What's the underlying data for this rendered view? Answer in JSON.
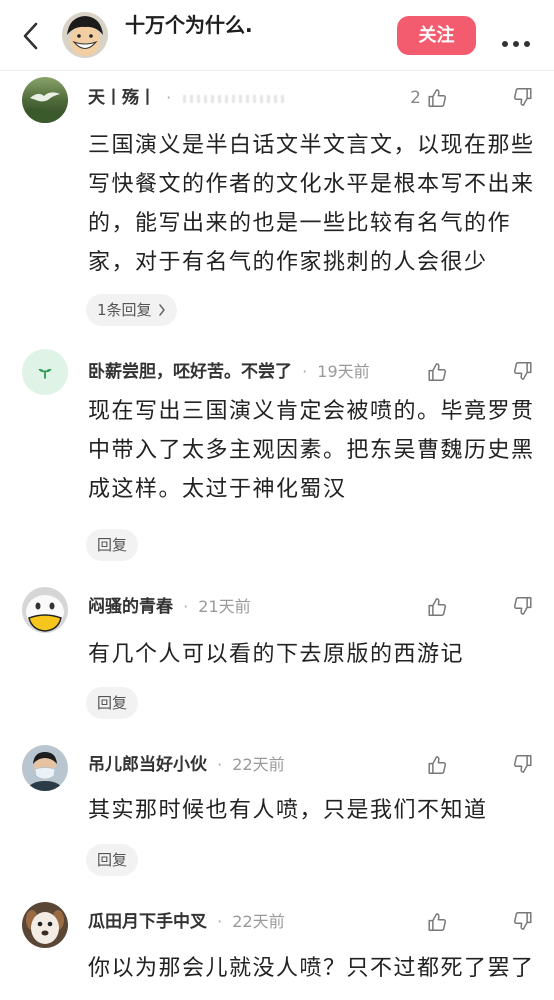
{
  "header": {
    "title": "十万个为什么.",
    "follow_label": "关注",
    "follow_color": "#f35b6e",
    "icons": {
      "back": "chevron-left-icon",
      "more": "more-dots-icon",
      "avatar": "anime-character-avatar"
    }
  },
  "separator": "·",
  "icons": {
    "like": "thumbs-up-icon",
    "dislike": "thumbs-down-icon",
    "reply_more": "chevron-right-icon"
  },
  "colors": {
    "text": "#222222",
    "secondary": "#999999",
    "reply_bg": "#f2f2f2",
    "accent": "#f35b6e"
  },
  "comments": [
    {
      "username": "天丨殇丨",
      "likes": "2",
      "text": "三国演义是半白话文半文言文，以现在那些写快餐文的作者的文化水平是根本写不出来的，能写出来的也是一些比较有名气的作家，对于有名气的作家挑刺的人会很少",
      "reply_label": "1条回复"
    },
    {
      "username": "卧薪尝胆，呸好苦。不尝了",
      "time": "19天前",
      "text": "现在写出三国演义肯定会被喷的。毕竟罗贯中带入了太多主观因素。把东吴曹魏历史黑成这样。太过于神化蜀汉",
      "reply_label": "回复"
    },
    {
      "username": "闷骚的青春",
      "time": "21天前",
      "text": "有几个人可以看的下去原版的西游记",
      "reply_label": "回复"
    },
    {
      "username": "吊儿郎当好小伙",
      "time": "22天前",
      "text": "其实那时候也有人喷，只是我们不知道",
      "reply_label": "回复"
    },
    {
      "username": "瓜田月下手中叉",
      "time": "22天前",
      "text": "你以为那会儿就没人喷？只不过都死了罢了"
    }
  ]
}
